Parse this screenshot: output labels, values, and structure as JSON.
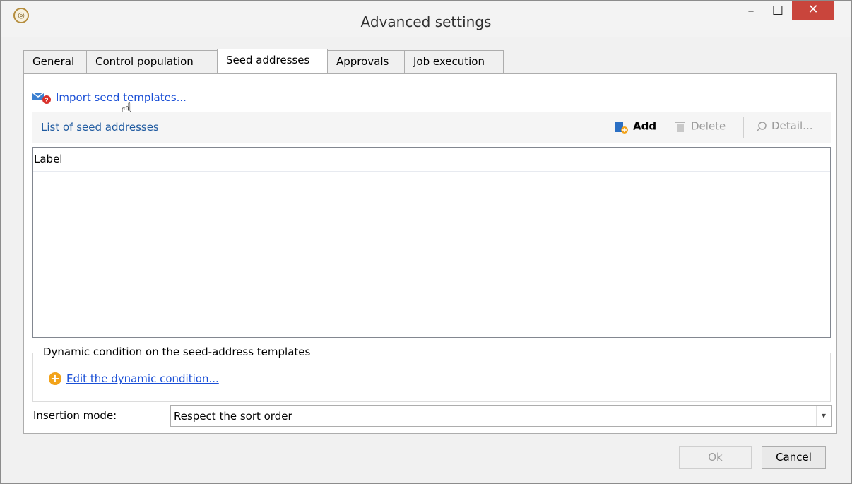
{
  "window": {
    "title": "Advanced settings",
    "minimize_glyph": "–",
    "maximize_glyph": "☐",
    "close_glyph": "✕"
  },
  "tabs": [
    {
      "label": "General",
      "active": false
    },
    {
      "label": "Control population",
      "active": false
    },
    {
      "label": "Seed addresses",
      "active": true
    },
    {
      "label": "Approvals",
      "active": false
    },
    {
      "label": "Job execution",
      "active": false
    }
  ],
  "import_link": {
    "label": "Import seed templates...",
    "icon": "import-envelope-icon"
  },
  "list": {
    "title": "List of seed addresses",
    "add_label": "Add",
    "delete_label": "Delete",
    "detail_label": "Detail...",
    "columns": [
      "Label"
    ]
  },
  "dynamic_condition": {
    "group_title": "Dynamic condition on the seed-address templates",
    "edit_link": "Edit the dynamic condition..."
  },
  "insertion": {
    "label": "Insertion mode:",
    "value": "Respect the sort order"
  },
  "buttons": {
    "ok_label": "Ok",
    "cancel_label": "Cancel"
  },
  "colors": {
    "link": "#1a4fd6",
    "list_title": "#1f5aa0",
    "close_button": "#c9453c",
    "edit_icon": "#f2a31b"
  }
}
